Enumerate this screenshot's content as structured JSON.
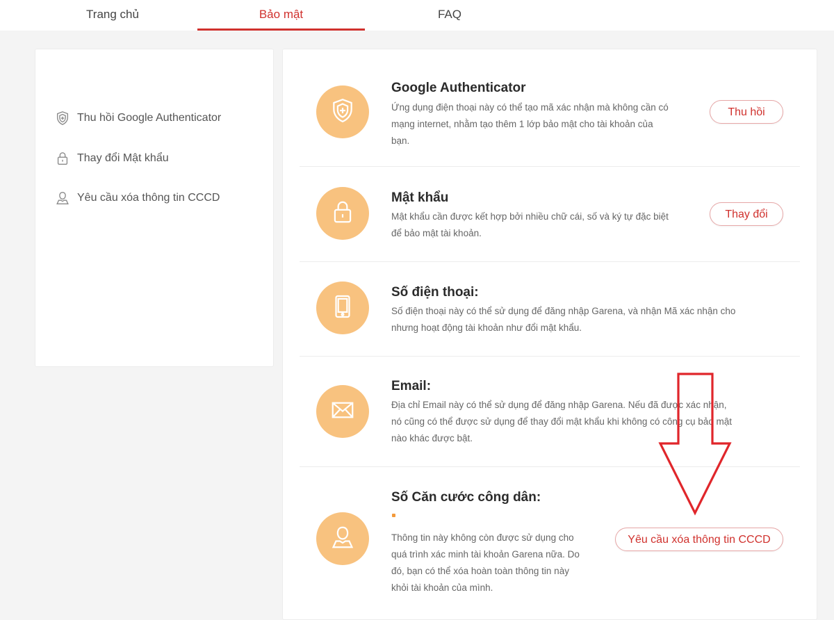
{
  "nav": {
    "tabs": [
      {
        "label": "Trang chủ"
      },
      {
        "label": "Bảo mật",
        "active": true
      },
      {
        "label": "FAQ"
      }
    ]
  },
  "sidebar": {
    "items": [
      {
        "label": "Thu hồi Google Authenticator",
        "icon": "shield-icon"
      },
      {
        "label": "Thay đổi Mật khẩu",
        "icon": "lock-icon"
      },
      {
        "label": "Yêu cầu xóa thông tin CCCD",
        "icon": "user-icon"
      }
    ]
  },
  "main": {
    "items": [
      {
        "title": "Google Authenticator",
        "desc_lines": [
          "Ứng dụng điện thoại này có thể tạo mã xác nhận mà không cần có",
          "mạng internet, nhằm tạo thêm 1 lớp bảo mật cho tài khoản của",
          "bạn."
        ],
        "button": "Thu hồi",
        "icon": "shield-icon"
      },
      {
        "title": "Mật khẩu",
        "desc_lines": [
          "Mật khẩu cần được kết hợp bởi nhiều chữ cái, số và ký tự đặc biệt",
          "để bảo mật tài khoản."
        ],
        "button": "Thay đổi",
        "icon": "lock-icon"
      },
      {
        "title": "Số điện thoại:",
        "desc_lines": [
          "Số điện thoại này có thể sử dụng để đăng nhập Garena, và nhận Mã xác nhận cho",
          "nhưng hoạt động tài khoản như đổi mật khẩu."
        ],
        "icon": "phone-icon"
      },
      {
        "title": "Email:",
        "desc_lines": [
          "Địa chỉ Email này có thể sử dụng để đăng nhập Garena. Nếu đã được xác nhận,",
          "nó cũng có thể được sử dụng để thay đổi mật khẩu khi không có công cụ bảo mật",
          "nào khác được bật."
        ],
        "icon": "envelope-icon"
      },
      {
        "title": "Số Căn cước công dân:",
        "desc_lines": [
          "Thông tin này không còn được sử dụng cho",
          "quá trình xác minh tài khoản Garena nữa. Do",
          "đó, bạn có thể xóa hoàn toàn thông tin này",
          "khỏi tài khoản của mình."
        ],
        "button": "Yêu cầu xóa thông tin CCCD",
        "icon": "user-icon"
      }
    ]
  },
  "colors": {
    "accent": "#d0312d",
    "icon_circle": "#f8c27f",
    "annotation_arrow": "#e0262b"
  }
}
